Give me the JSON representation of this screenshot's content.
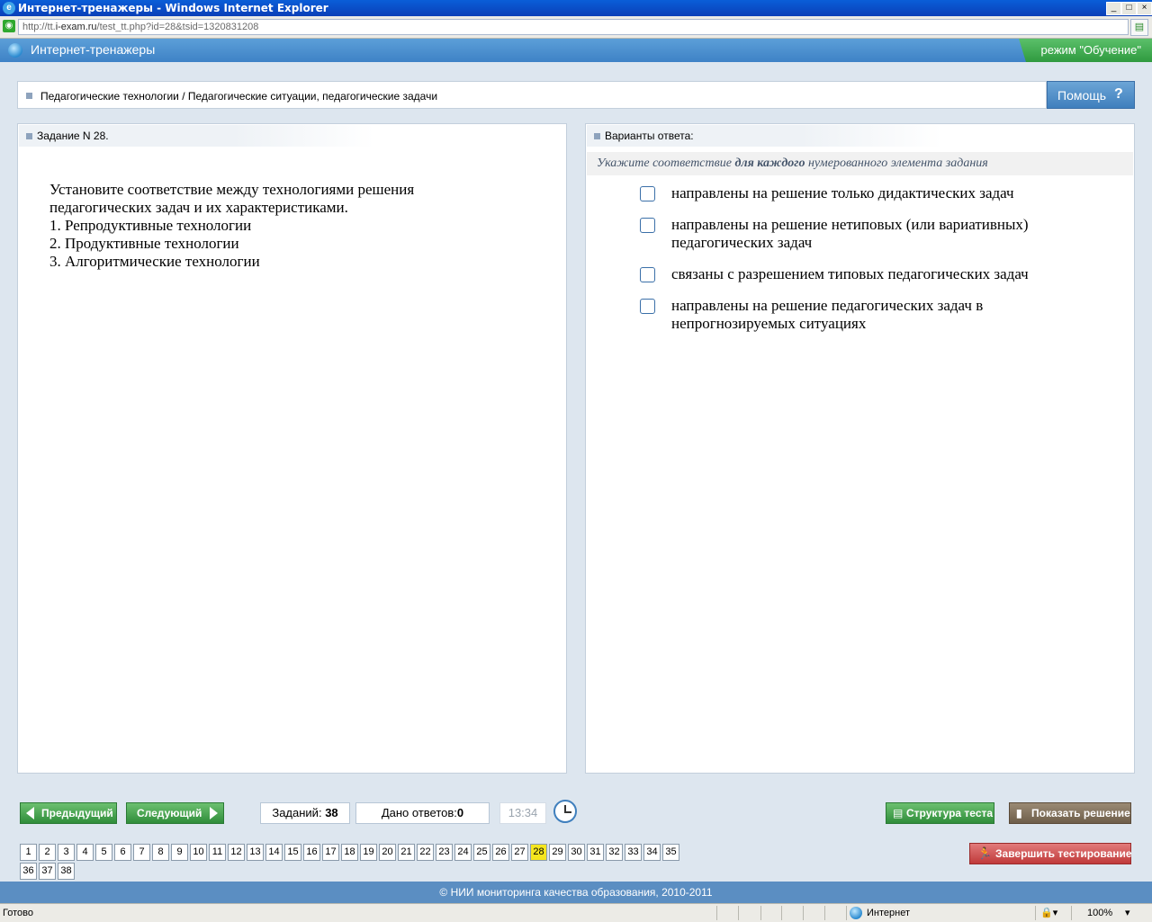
{
  "window": {
    "title": "Интернет-тренажеры - Windows Internet Explorer",
    "url_prefix": "http://tt.",
    "url_domain": "i-exam.ru",
    "url_rest": "/test_tt.php?id=28&tsid=1320831208"
  },
  "app": {
    "title": "Интернет-тренажеры",
    "mode": "режим \"Обучение\""
  },
  "breadcrumb": "Педагогические технологии / Педагогические ситуации, педагогические задачи",
  "help_label": "Помощь",
  "task": {
    "header": "Задание N 28.",
    "lines": [
      "Установите соответствие между технологиями решения",
      "педагогических задач и их характеристиками.",
      "1. Репродуктивные технологии",
      "2. Продуктивные технологии",
      "3. Алгоритмические технологии"
    ]
  },
  "answers": {
    "header": "Варианты ответа:",
    "instruction_pre": "Укажите соответствие ",
    "instruction_bold": "для каждого",
    "instruction_post": " нумерованного элемента задания",
    "options": [
      "направлены на решение только дидактических задач",
      "направлены на решение нетиповых (или вариативных) педагогических задач",
      "связаны с разрешением типовых педагогических задач",
      "направлены на решение педагогических задач в непрогнозируемых ситуациях"
    ]
  },
  "nav": {
    "prev": "Предыдущий",
    "next": "Следующий",
    "tasks_label": "Заданий:",
    "tasks_count": "38",
    "answered_label": "Дано ответов:",
    "answered_count": "0",
    "timer": "13:34",
    "structure": "Структура теста",
    "show_solution": "Показать решение",
    "finish": "Завершить тестирование",
    "current_question": 28,
    "question_numbers": [
      "1",
      "2",
      "3",
      "4",
      "5",
      "6",
      "7",
      "8",
      "9",
      "10",
      "11",
      "12",
      "13",
      "14",
      "15",
      "16",
      "17",
      "18",
      "19",
      "20",
      "21",
      "22",
      "23",
      "24",
      "25",
      "26",
      "27",
      "28",
      "29",
      "30",
      "31",
      "32",
      "33",
      "34",
      "35",
      "36",
      "37",
      "38"
    ]
  },
  "footer": "© НИИ мониторинга качества образования, 2010-2011",
  "status": {
    "ready": "Готово",
    "zone": "Интернет",
    "zoom": "100%"
  }
}
